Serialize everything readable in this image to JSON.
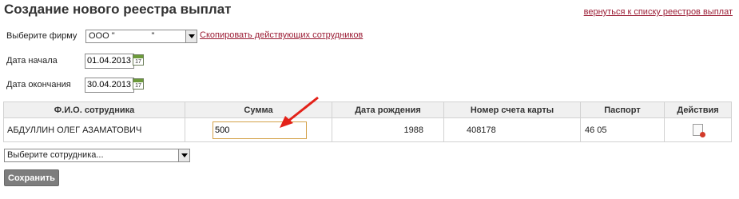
{
  "page": {
    "title": "Создание нового реестра выплат",
    "back_link": "вернуться к списку реестров выплат"
  },
  "form": {
    "firm_label": "Выберите фирму",
    "firm_value": "ООО \"               \"",
    "copy_link": "Скопировать действующих сотрудников",
    "start_label": "Дата начала",
    "start_value": "01.04.2013",
    "end_label": "Дата окончания",
    "end_value": "30.04.2013",
    "calendar_icon_text": "17"
  },
  "table": {
    "headers": [
      "Ф.И.О. сотрудника",
      "Сумма",
      "Дата рождения",
      "Номер счета карты",
      "Паспорт",
      "Действия"
    ],
    "rows": [
      {
        "name": "АБДУЛЛИН ОЛЕГ АЗАМАТОВИЧ",
        "sum": "500",
        "birth_year": "1988",
        "card": "408178",
        "passport": "46 05",
        "action_icon": "delete-document-icon"
      }
    ]
  },
  "employee_select": {
    "placeholder": "Выберите сотрудника..."
  },
  "actions": {
    "save_label": "Сохранить"
  },
  "colors": {
    "link": "#9b1d35",
    "arrow": "#e32219",
    "input_focus": "#d4a24a",
    "button": "#7d7d7d"
  }
}
